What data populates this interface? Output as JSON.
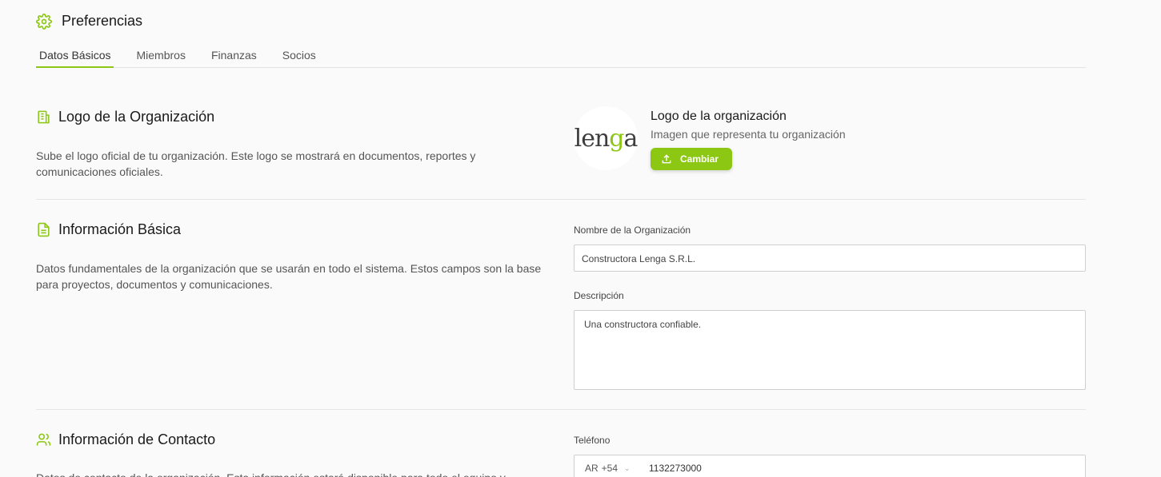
{
  "header": {
    "title": "Preferencias",
    "icon": "gear-icon",
    "accent": "#8cc714"
  },
  "tabs": [
    {
      "label": "Datos Básicos",
      "active": true
    },
    {
      "label": "Miembros",
      "active": false
    },
    {
      "label": "Finanzas",
      "active": false
    },
    {
      "label": "Socios",
      "active": false
    }
  ],
  "logo_section": {
    "title": "Logo de la Organización",
    "icon": "building-icon",
    "description": "Sube el logo oficial de tu organización. Este logo se mostrará en documentos, reportes y comunicaciones oficiales.",
    "logo_word_a": "len",
    "logo_word_b": "g",
    "logo_word_c": "a",
    "card_title": "Logo de la organización",
    "card_subtitle": "Imagen que representa tu organización",
    "change_button": "Cambiar"
  },
  "basic_section": {
    "title": "Información Básica",
    "icon": "document-icon",
    "description": "Datos fundamentales de la organización que se usarán en todo el sistema. Estos campos son la base para proyectos, documentos y comunicaciones.",
    "name_label": "Nombre de la Organización",
    "name_value": "Constructora Lenga S.R.L.",
    "description_label": "Descripción",
    "description_value": "Una constructora confiable."
  },
  "contact_section": {
    "title": "Información de Contacto",
    "icon": "users-icon",
    "description": "Datos de contacto de la organización. Esta información estará disponible para todo el equipo y",
    "phone_label": "Teléfono",
    "phone_country": "AR",
    "phone_code": "+54",
    "phone_value": "1132273000"
  }
}
